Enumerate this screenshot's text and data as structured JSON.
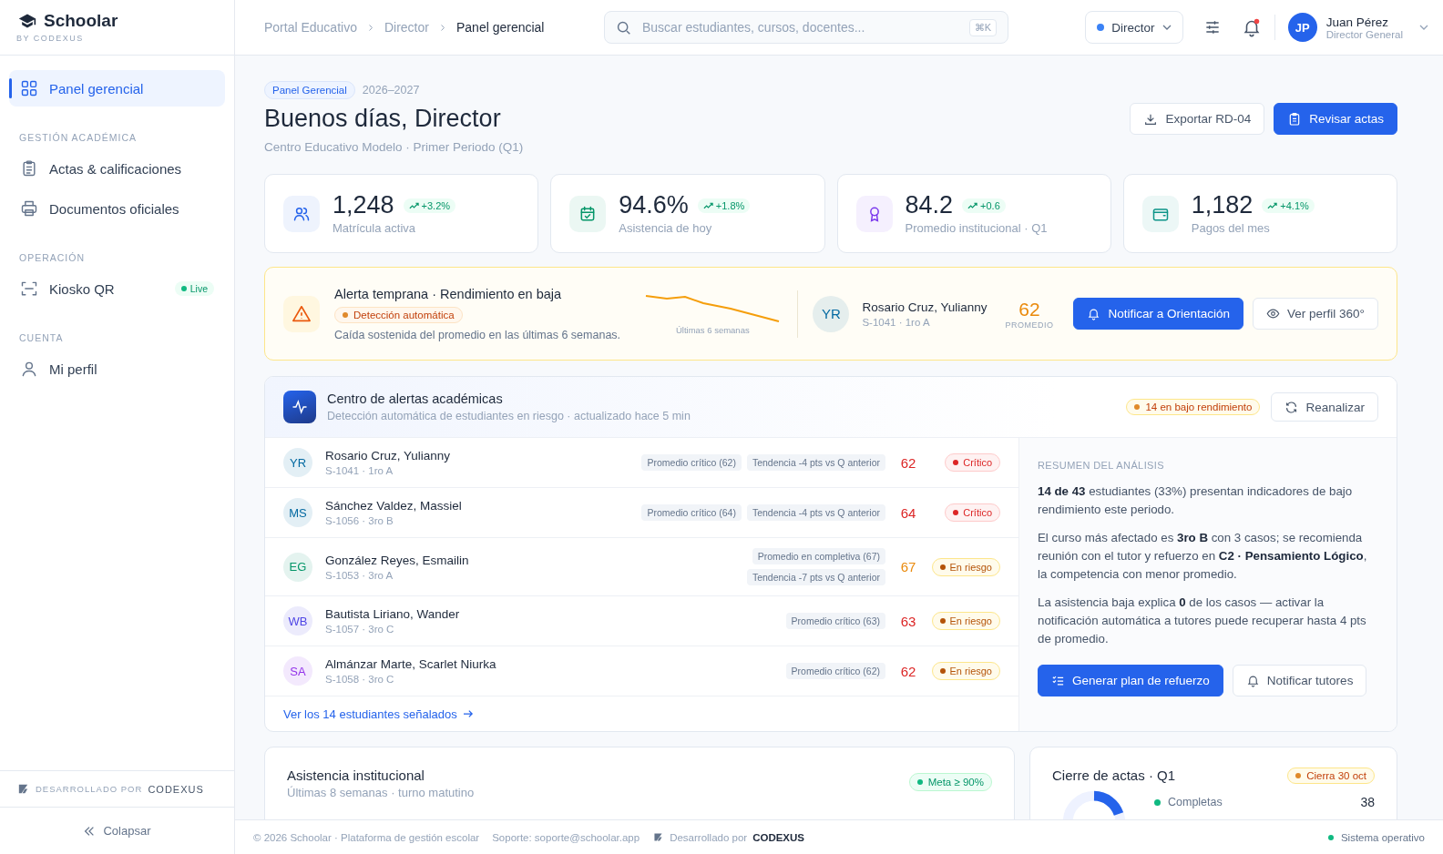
{
  "brand": {
    "name": "Schoolar",
    "sub": "BY CODEXUS"
  },
  "sidebar": {
    "sections": [
      {
        "items": [
          {
            "label": "Panel gerencial",
            "selected": true
          }
        ]
      },
      {
        "heading": "GESTIÓN ACADÉMICA",
        "items": [
          {
            "label": "Actas & calificaciones",
            "selected": false
          },
          {
            "label": "Documentos oficiales",
            "selected": false
          }
        ]
      },
      {
        "heading": "OPERACIÓN",
        "items": [
          {
            "label": "Kiosko QR",
            "selected": false,
            "badge": "Live"
          }
        ]
      },
      {
        "heading": "CUENTA",
        "items": [
          {
            "label": "Mi perfil",
            "selected": false
          }
        ]
      }
    ],
    "dev_label": "DESARROLLADO POR",
    "dev_brand": "CODEXUS",
    "collapse": "Colapsar"
  },
  "header": {
    "breadcrumbs": [
      "Portal Educativo",
      "Director",
      "Panel gerencial"
    ],
    "search": {
      "placeholder": "Buscar estudiantes, cursos, docentes...",
      "shortcut": "⌘K"
    },
    "role": "Director",
    "notifications_unread": true,
    "user": {
      "initials": "JP",
      "name": "Juan Pérez",
      "title": "Director General"
    }
  },
  "page": {
    "tag": "Panel Gerencial",
    "year": "2026–2027",
    "title": "Buenos días, Director",
    "subtitle": "Centro Educativo Modelo · Primer Periodo (Q1)",
    "buttons": [
      {
        "label": "Exportar RD-04",
        "kind": "secondary"
      },
      {
        "label": "Revisar actas",
        "kind": "primary"
      }
    ]
  },
  "stats": [
    {
      "value": "1,248",
      "delta": "+3.2%",
      "label": "Matrícula activa",
      "color": "#2563eb"
    },
    {
      "value": "94.6%",
      "delta": "+1.8%",
      "label": "Asistencia de hoy",
      "color": "#059669"
    },
    {
      "value": "84.2",
      "delta": "+0.6",
      "label": "Promedio institucional · Q1",
      "color": "#7c3aed"
    },
    {
      "value": "1,182",
      "delta": "+4.1%",
      "label": "Pagos del mes",
      "color": "#0d9488"
    }
  ],
  "early_alert": {
    "title": "Alerta temprana · Rendimiento en baja",
    "tag": "Detección automática",
    "text": "Caída sostenida del promedio en las últimas 6 semanas.",
    "trend_caption": "Últimas 6 semanas",
    "student": {
      "initials": "YR",
      "name": "Rosario Cruz, Yulianny",
      "meta": "S-1041 · 1ro A"
    },
    "score": "62",
    "score_label": "PROMEDIO",
    "buttons": [
      {
        "label": "Notificar a Orientación",
        "kind": "primary"
      },
      {
        "label": "Ver perfil 360°",
        "kind": "secondary"
      }
    ]
  },
  "alert_center": {
    "title": "Centro de alertas académicas",
    "subtitle": "Detección automática de estudiantes en riesgo · actualizado hace 5 min",
    "count_badge": "14 en bajo rendimiento",
    "reanalyze": "Reanalizar",
    "students": [
      {
        "initials": "YR",
        "color": "#0369a1",
        "name": "Rosario Cruz, Yulianny",
        "meta": "S-1041 · 1ro A",
        "tags": [
          "Promedio crítico (62)",
          "Tendencia -4 pts vs Q anterior"
        ],
        "score": {
          "value": "62",
          "color": "#dc2626"
        },
        "status": {
          "kind": "critical",
          "label": "Crítico"
        }
      },
      {
        "initials": "MS",
        "color": "#0369a1",
        "name": "Sánchez Valdez, Massiel",
        "meta": "S-1056 · 3ro B",
        "tags": [
          "Promedio crítico (64)",
          "Tendencia -4 pts vs Q anterior"
        ],
        "score": {
          "value": "64",
          "color": "#dc2626"
        },
        "status": {
          "kind": "critical",
          "label": "Crítico"
        }
      },
      {
        "initials": "EG",
        "color": "#059669",
        "name": "González Reyes, Esmailin",
        "meta": "S-1053 · 3ro A",
        "tags": [
          "Promedio en completiva (67)",
          "Tendencia -7 pts vs Q anterior"
        ],
        "score": {
          "value": "67",
          "color": "#ea8a0c"
        },
        "status": {
          "kind": "risk",
          "label": "En riesgo"
        }
      },
      {
        "initials": "WB",
        "color": "#4f46e5",
        "name": "Bautista Liriano, Wander",
        "meta": "S-1057 · 3ro C",
        "tags": [
          "Promedio crítico (63)"
        ],
        "score": {
          "value": "63",
          "color": "#dc2626"
        },
        "status": {
          "kind": "risk",
          "label": "En riesgo"
        }
      },
      {
        "initials": "SA",
        "color": "#9333ea",
        "name": "Almánzar Marte, Scarlet Niurka",
        "meta": "S-1058 · 3ro C",
        "tags": [
          "Promedio crítico (62)"
        ],
        "score": {
          "value": "62",
          "color": "#dc2626"
        },
        "status": {
          "kind": "risk",
          "label": "En riesgo"
        }
      }
    ],
    "link": "Ver los 14 estudiantes señalados",
    "summary": {
      "heading": "RESUMEN DEL ANÁLISIS",
      "paragraphs": [
        "**14 de 43** estudiantes (33%) presentan indicadores de bajo rendimiento este periodo.",
        "El curso más afectado es **3ro B** con 3 casos; se recomienda reunión con el tutor y refuerzo en **C2 · Pensamiento Lógico**, la competencia con menor promedio.",
        "La asistencia baja explica **0** de los casos — activar la notificación automática a tutores puede recuperar hasta 4 pts de promedio."
      ],
      "buttons": [
        {
          "label": "Generar plan de refuerzo",
          "kind": "primary"
        },
        {
          "label": "Notificar tutores",
          "kind": "secondary"
        }
      ]
    }
  },
  "attendance": {
    "title": "Asistencia institucional",
    "subtitle": "Últimas 8 semanas · turno matutino",
    "badge": "Meta ≥ 90%"
  },
  "closing": {
    "title": "Cierre de actas · Q1",
    "badge": "Cierra 30 oct",
    "legend": [
      {
        "label": "Completas",
        "value": "38",
        "color": "#10b981"
      }
    ]
  },
  "footer": {
    "copyright": "© 2026 Schoolar · Plataforma de gestión escolar",
    "support": "Soporte: soporte@schoolar.app",
    "dev_label": "Desarrollado por",
    "dev_brand": "CODEXUS",
    "status": "Sistema operativo"
  }
}
